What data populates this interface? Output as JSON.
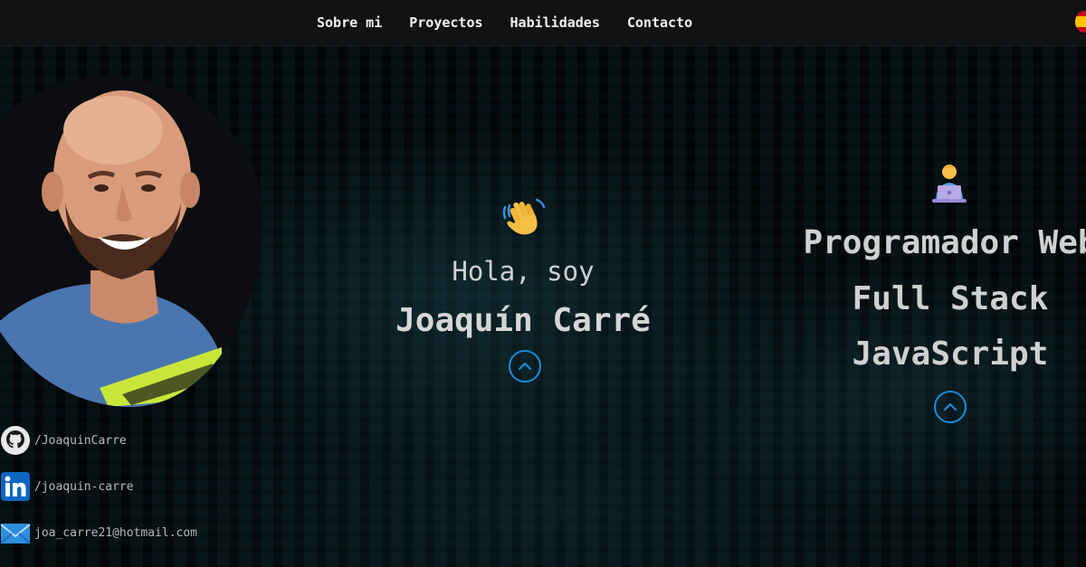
{
  "nav": {
    "items": [
      {
        "label": "Sobre mi"
      },
      {
        "label": "Proyectos"
      },
      {
        "label": "Habilidades"
      },
      {
        "label": "Contacto"
      }
    ],
    "language_flag": "spain-flag-icon"
  },
  "hero": {
    "greeting": "Hola, soy",
    "name": "Joaquín Carré",
    "greeting_icon": "waving-hand-icon",
    "scroll_icon": "chevron-up-icon"
  },
  "roles": {
    "icon": "technologist-icon",
    "lines": [
      "Programador Web",
      "Full Stack",
      "JavaScript"
    ]
  },
  "social": [
    {
      "icon": "github-icon",
      "text": "/JoaquinCarre"
    },
    {
      "icon": "linkedin-icon",
      "text": "/joaquin-carre"
    },
    {
      "icon": "mail-icon",
      "text": "joa_carre21@hotmail.com"
    }
  ],
  "colors": {
    "accent": "#1a8cd8",
    "nav_bg": "#111213",
    "text": "#d6d6d6"
  }
}
